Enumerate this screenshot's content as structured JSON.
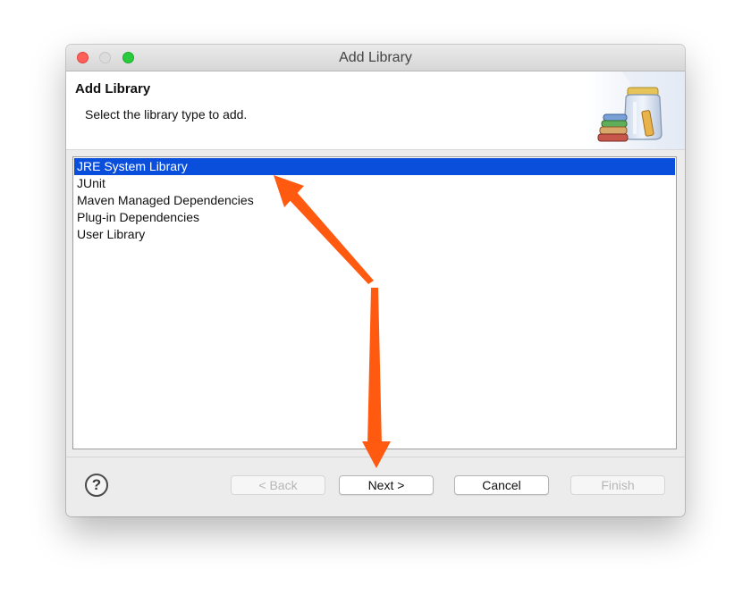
{
  "window": {
    "title": "Add Library",
    "controls": [
      "close",
      "minimize",
      "zoom"
    ]
  },
  "header": {
    "title": "Add Library",
    "description": "Select the library type to add.",
    "graphic_icon": "library-jar-icon"
  },
  "library_types": {
    "selected_index": 0,
    "items": [
      {
        "label": "JRE System Library"
      },
      {
        "label": "JUnit"
      },
      {
        "label": "Maven Managed Dependencies"
      },
      {
        "label": "Plug-in Dependencies"
      },
      {
        "label": "User Library"
      }
    ]
  },
  "footer": {
    "help_icon": "help-icon",
    "help_glyph": "?",
    "back_label": "< Back",
    "next_label": "Next >",
    "cancel_label": "Cancel",
    "finish_label": "Finish"
  },
  "colors": {
    "selection": "#0a4fdb",
    "annotation_arrow": "#ff5a10",
    "close": "#fe5f57",
    "zoom": "#2aca3e"
  }
}
